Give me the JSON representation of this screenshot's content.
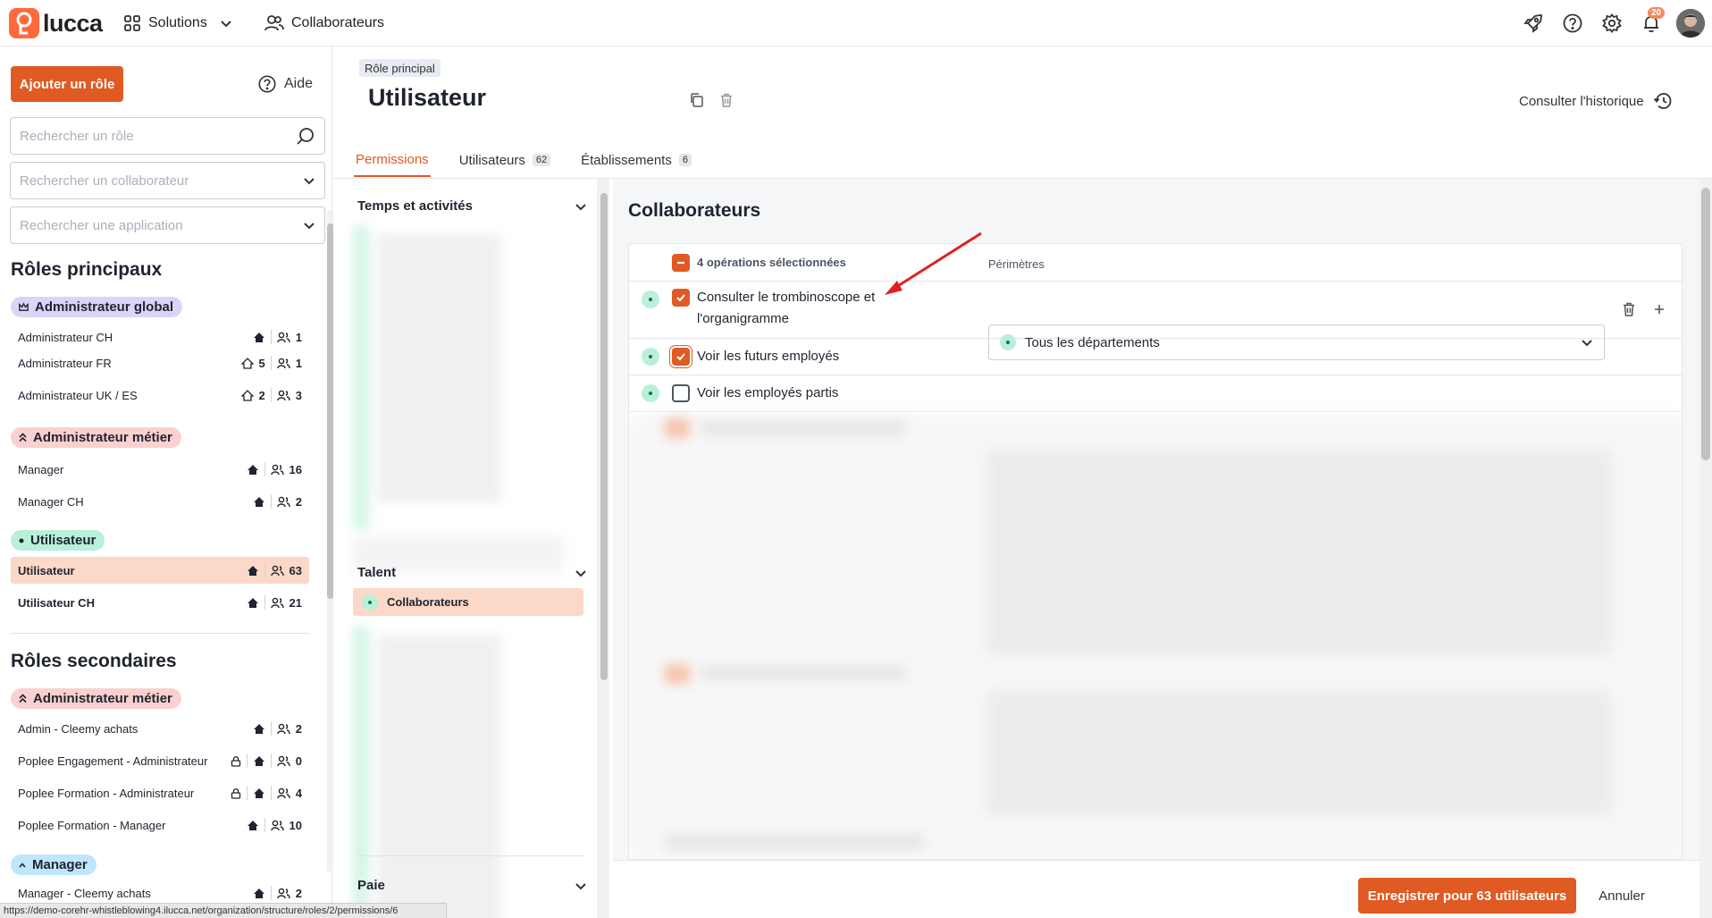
{
  "topbar": {
    "logo_text": "lucca",
    "solutions_label": "Solutions",
    "collaborateurs_label": "Collaborateurs",
    "notifications_count": "20",
    "accent_color": "#e05a24"
  },
  "sidebar": {
    "add_role_label": "Ajouter un rôle",
    "help_label": "Aide",
    "search_role_placeholder": "Rechercher un rôle",
    "search_collab_placeholder": "Rechercher un collaborateur",
    "search_app_placeholder": "Rechercher une application",
    "principal_title": "Rôles principaux",
    "secondary_title": "Rôles secondaires",
    "groups": {
      "admin_global": "Administrateur global",
      "admin_metier": "Administrateur métier",
      "utilisateur": "Utilisateur",
      "admin_metier_2": "Administrateur métier",
      "manager": "Manager"
    },
    "roles": [
      {
        "name": "Administrateur CH",
        "scope": "",
        "users": "1"
      },
      {
        "name": "Administrateur FR",
        "scope": "5",
        "users": "1"
      },
      {
        "name": "Administrateur UK / ES",
        "scope": "2",
        "users": "3"
      },
      {
        "name": "Manager",
        "scope": "",
        "users": "16"
      },
      {
        "name": "Manager CH",
        "scope": "",
        "users": "2"
      },
      {
        "name": "Utilisateur",
        "scope": "",
        "users": "63"
      },
      {
        "name": "Utilisateur CH",
        "scope": "",
        "users": "21"
      },
      {
        "name": "Admin - Cleemy achats",
        "scope": "",
        "users": "2"
      },
      {
        "name": "Poplee Engagement - Administrateur",
        "scope": "",
        "users": "0"
      },
      {
        "name": "Poplee Formation - Administrateur",
        "scope": "",
        "users": "4"
      },
      {
        "name": "Poplee Formation - Manager",
        "scope": "",
        "users": "10"
      },
      {
        "name": "Manager - Cleemy achats",
        "scope": "",
        "users": "2"
      }
    ]
  },
  "header": {
    "role_badge": "Rôle principal",
    "title": "Utilisateur",
    "history_label": "Consulter l'historique"
  },
  "tabs": [
    {
      "label": "Permissions",
      "count": ""
    },
    {
      "label": "Utilisateurs",
      "count": "62"
    },
    {
      "label": "Établissements",
      "count": "6"
    }
  ],
  "apps": {
    "group_temps": "Temps et activités",
    "group_talent": "Talent",
    "active_item": "Collaborateurs",
    "group_paie": "Paie"
  },
  "panel": {
    "title": "Collaborateurs",
    "selected_ops": "4 opérations sélectionnées",
    "perimetres_header": "Périmètres",
    "operations": [
      {
        "label": "Consulter le trombinoscope et l'organigramme",
        "checked": true
      },
      {
        "label": "Voir les futurs employés",
        "checked": true
      },
      {
        "label": "Voir les employés partis",
        "checked": false
      }
    ],
    "perimeter_value": "Tous les départements"
  },
  "footer": {
    "save_label": "Enregistrer pour 63 utilisateurs",
    "cancel_label": "Annuler"
  },
  "statusbar": {
    "url": "https://demo-corehr-whistleblowing4.ilucca.net/organization/structure/roles/2/permissions/6"
  }
}
